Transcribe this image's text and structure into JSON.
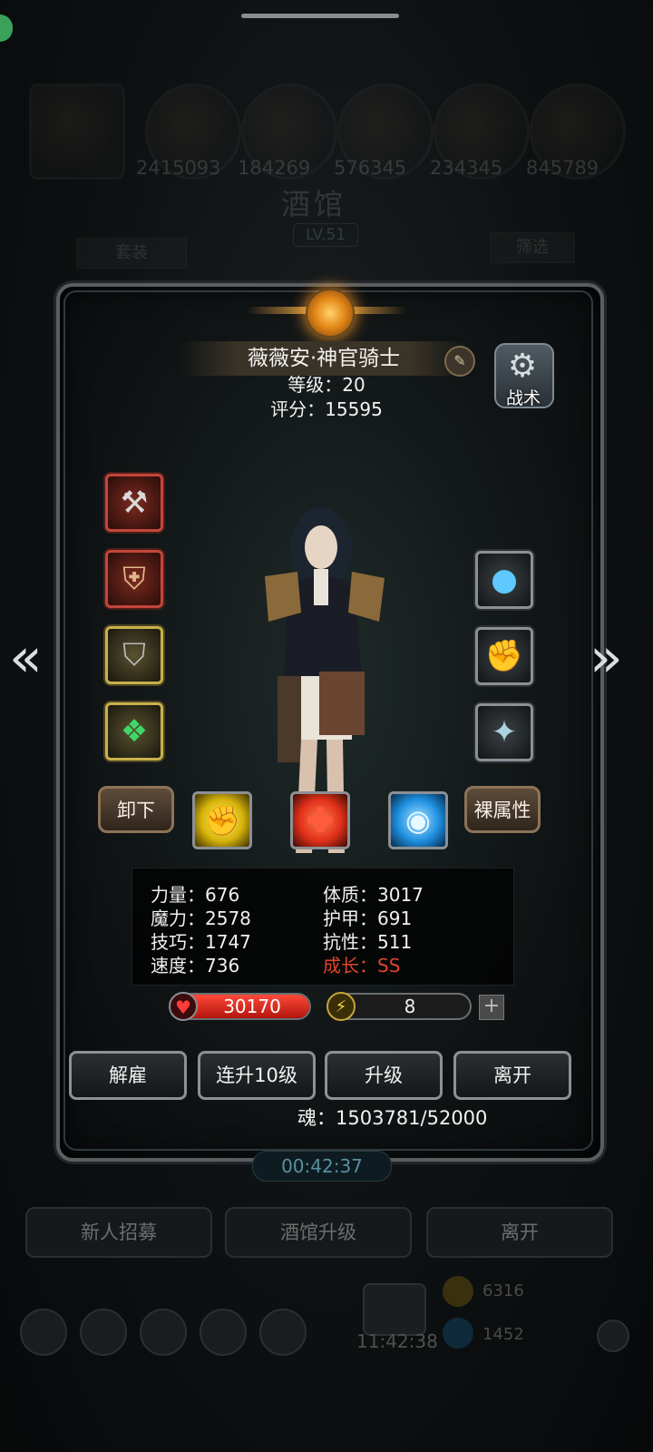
{
  "background": {
    "resource_counts": [
      "2415093",
      "184269",
      "576345",
      "234345",
      "845789"
    ],
    "tavern_title": "酒馆",
    "tavern_level": "LV.51",
    "set_button": "套装",
    "filter_button": "筛选",
    "timer": "00:42:37",
    "bottom_buttons": [
      "新人招募",
      "酒馆升级",
      "离开"
    ],
    "clock": "11:42:38",
    "gold": "6316",
    "gems": "1452"
  },
  "hero": {
    "name": "薇薇安·神官骑士",
    "level_label": "等级：20",
    "score_label": "评分：15595",
    "tactics_label": "战术",
    "unequip_label": "卸下",
    "naked_attr_label": "裸属性"
  },
  "stats": {
    "left": [
      "力量：676",
      "魔力：2578",
      "技巧：1747",
      "速度：736"
    ],
    "right": [
      "体质：3017",
      "护甲：691",
      "抗性：511"
    ],
    "growth": "成长：SS"
  },
  "bars": {
    "hp": "30170",
    "hp_fill": 1.0,
    "energy": "8",
    "energy_fill": 0.08
  },
  "actions": [
    "解雇",
    "连升10级",
    "升级",
    "离开"
  ],
  "soul": "魂：1503781/52000",
  "icons": {
    "left_slots": [
      "hammer-icon",
      "armor-icon",
      "shield-icon",
      "emerald-icon"
    ],
    "right_slots": [
      "orb-icon",
      "gauntlet-icon",
      "crest-icon"
    ],
    "skills": [
      "fist-icon",
      "heal-cross-icon",
      "eye-icon"
    ]
  },
  "colors": {
    "growth_red": "#e0452d",
    "hp_red": "#d0201a",
    "energy_gold": "#e0b020"
  }
}
